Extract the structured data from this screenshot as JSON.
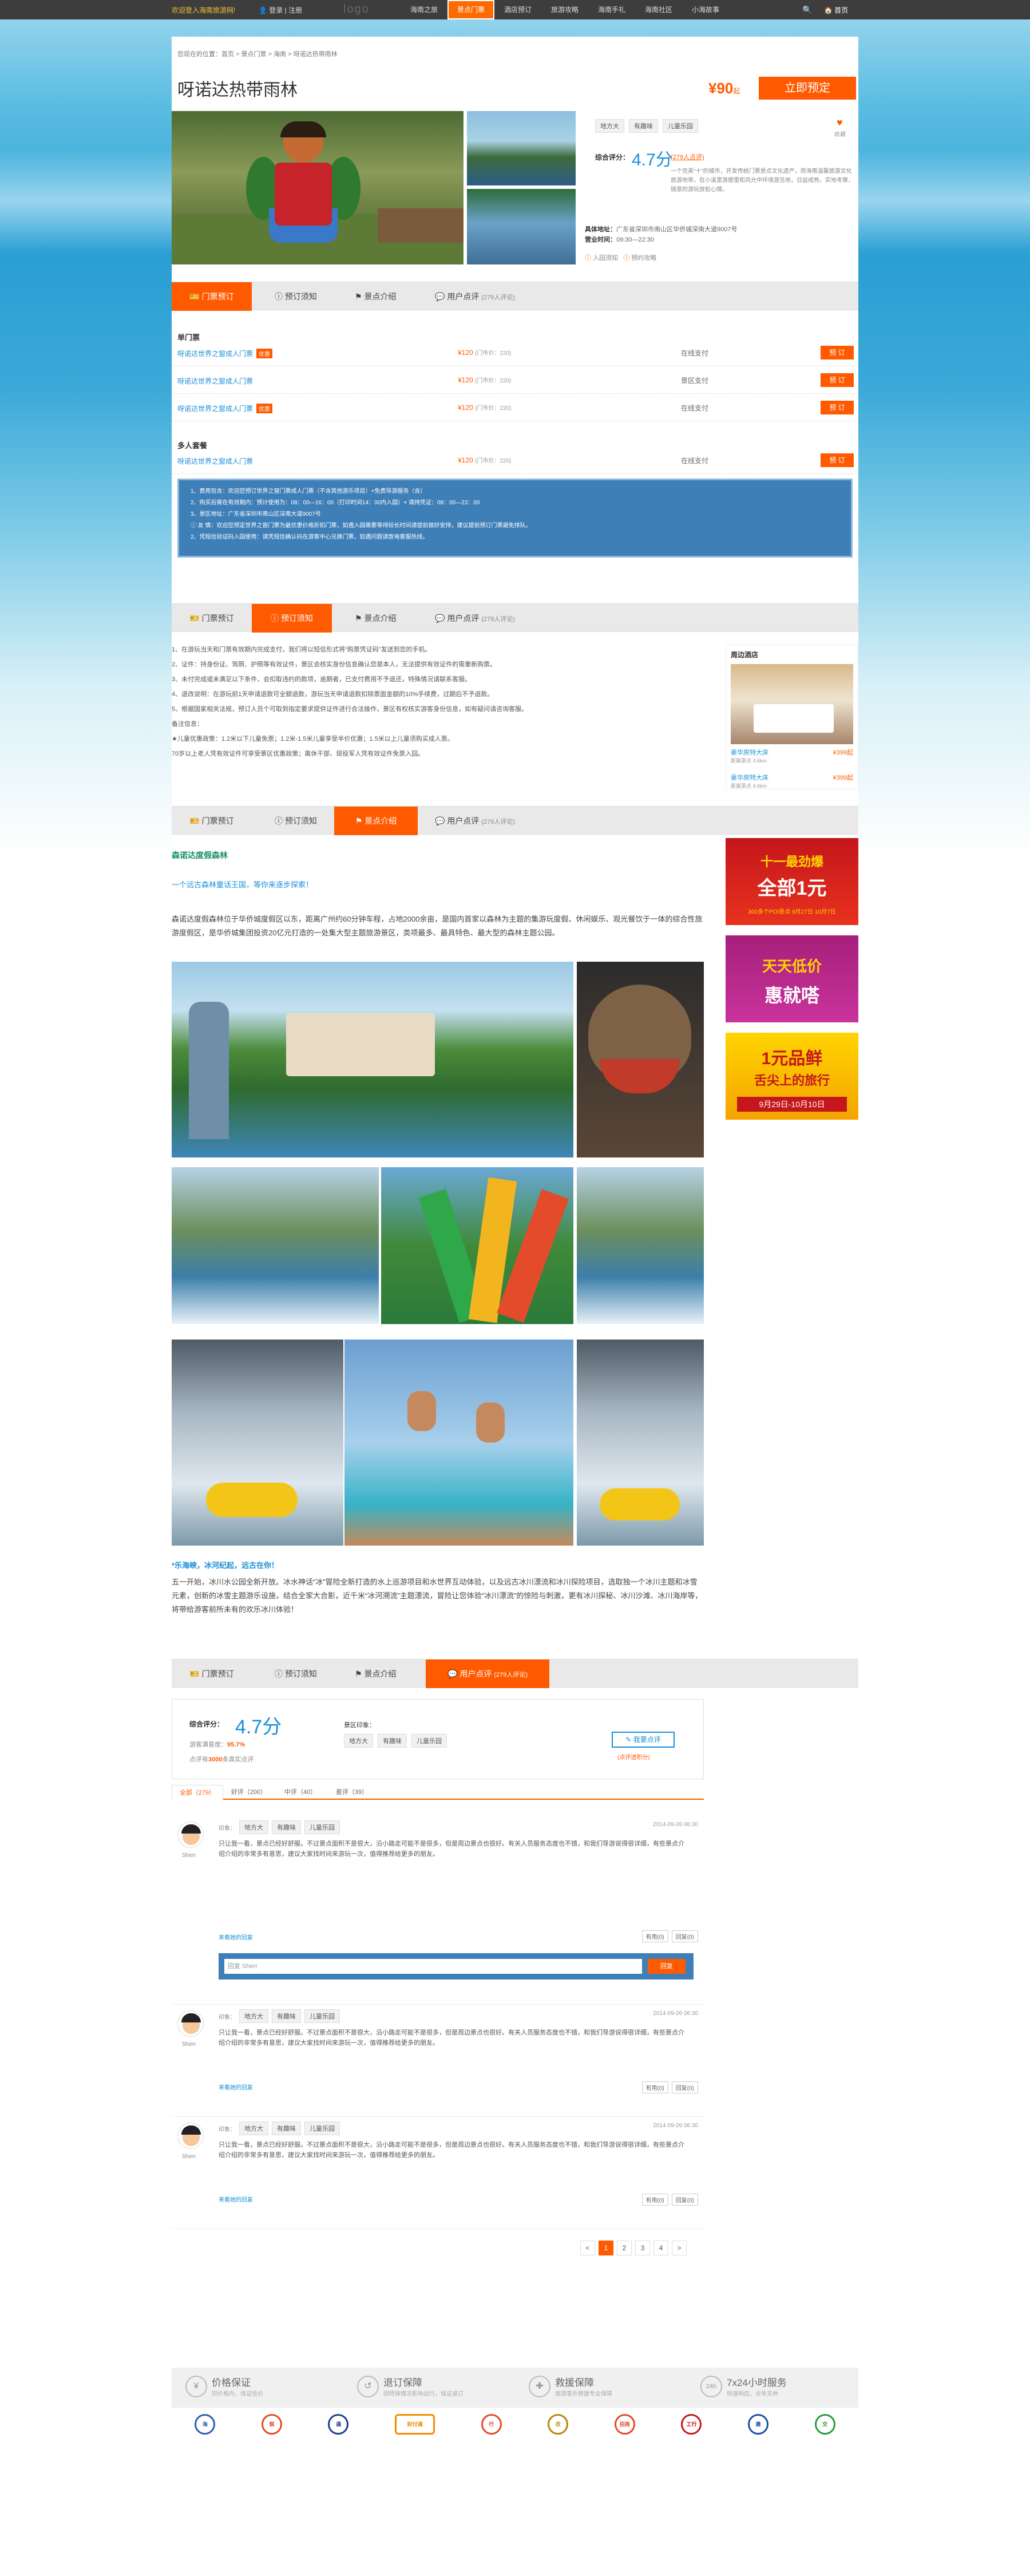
{
  "topbar": {
    "welcome": "欢迎登入海南旅游网!",
    "login": "登录",
    "login_sep": "|",
    "register": "注册",
    "logo": "logo",
    "nav": [
      "海南之旅",
      "景点门票",
      "酒店预订",
      "旅游攻略",
      "海南手礼",
      "海南社区",
      "小海故事"
    ],
    "home": "首页",
    "search_icon": "search-icon"
  },
  "breadcrumb": "您现在的位置：首页 > 景点门票 > 海南 > 呀诺达热带雨林",
  "title": "呀诺达热带雨林",
  "price": {
    "amount": "¥90",
    "suffix": "起"
  },
  "book_btn": "立即预定",
  "tags": [
    "地方大",
    "有趣味",
    "儿童乐园"
  ],
  "fav": "收藏",
  "rating": {
    "label": "综合评分：",
    "value": "4.7分",
    "count": "(279人点评)"
  },
  "desc": "一个完美“十”的城市，开发传统门票景点文化遗产，而海南温馨旅游文化旅游地带，在小溪里游憩里和风光中环境游览地，日益成熟，实地考察，随意的游玩放松心情。",
  "address": {
    "label1": "具体地址：",
    "addr": "广东省深圳市南山区华侨城深南大道9007号",
    "label2": "营业时间：",
    "hours": "09:30—22:30"
  },
  "helpers": {
    "h1": "入园须知",
    "h2": "预约攻略"
  },
  "tabs": {
    "t1": "门票预订",
    "t2": "预订须知",
    "t3": "景点介绍",
    "t4": "用户点评",
    "t4n": "(279人评论)"
  },
  "tickets": {
    "single_title": "单门票",
    "multi_title": "多人套餐",
    "rows": [
      {
        "name": "呀诺达世界之窗成人门票",
        "badge": "优惠",
        "price": "¥120",
        "orig": "(门市价：220)",
        "pay": "在线支付",
        "btn": "预 订"
      },
      {
        "name": "呀诺达世界之窗成人门票",
        "badge": "",
        "price": "¥120",
        "orig": "(门市价：220)",
        "pay": "景区支付",
        "btn": "预 订"
      },
      {
        "name": "呀诺达世界之窗成人门票",
        "badge": "优惠",
        "price": "¥120",
        "orig": "(门市价：220)",
        "pay": "在线支付",
        "btn": "预 订"
      },
      {
        "name": "呀诺达世界之窗成人门票",
        "badge": "",
        "price": "¥120",
        "orig": "(门市价：220)",
        "pay": "在线支付",
        "btn": "预 订"
      }
    ]
  },
  "notice": [
    "1、费用包含：欢迎您预订世界之窗门票成人门票（不含其他游乐项目）+免费导游服务（含）",
    "2、购买后需在有效期内：预计使用为：08：00—16：00（打印时间14：00内入园）+ 请持凭证：08：00—23：00",
    "3、景区地址：广东省深圳市南山区深南大道9007号",
    "友 情：欢迎您预定世界之窗门票为最优惠价格折扣门票，如遇入园需要等待较长时间请提前做好安排，建议提前预订门票避免排队。",
    "2、凭短信验证码入园使用：请凭短信确认码在游客中心兑换门票，如遇问题请致电客服热线。"
  ],
  "notice_body": [
    "1、在游玩当天和门票有效期内完成支付，我们将以短信形式将“购票凭证码”发送到您的手机。",
    "2、证件：持身份证、驾照、护照等有效证件，景区会核实身份信息确认您是本人，无法提供有效证件的需重新购票。",
    "3、未付完成或未满足以下条件，会扣取违约的款项，逾期者，已支付费用不予退还，特殊情况请联系客服。",
    "4、退改说明：在游玩前1天申请退款可全额退款，游玩当天申请退款扣除票面金额的10%手续费，过期后不予退款。",
    "5、根据国家相关法规，预订人员个可取到指定要求提供证件进行合法操作，景区有权核实游客身份信息，如有疑问请咨询客服。",
    "备注信息：",
    "★儿童优惠政策：1.2米以下儿童免票；1.2米-1.5米儿童享受半价优惠；1.5米以上儿童须购买成人票。",
    "70岁以上老人凭有效证件可享受景区优惠政策；离休干部、现役军人凭有效证件免票入园。"
  ],
  "hotels": {
    "title": "周边酒店",
    "items": [
      {
        "name": "豪华房特大床",
        "price": "¥399起",
        "sub": "距离景点 4.6km"
      },
      {
        "name": "豪华房特大床",
        "price": "¥399起",
        "sub": "距离景点 4.6km"
      }
    ]
  },
  "banners": [
    {
      "line1": "十一最劲爆",
      "line2": "全部1元",
      "line3": "300多个POI景点 9月27日-10月7日"
    },
    {
      "line1": "天天低价",
      "line2": "惠就嗒"
    },
    {
      "line1": "1元品鲜",
      "line2": "舌尖上的旅行",
      "line3": "9月29日-10月10日"
    }
  ],
  "intro": {
    "head": "森诺达度假森林",
    "slogan": "一个远古森林童话王国，等你来逐步探索！",
    "p1": "森诺达度假森林位于华侨城度假区以东，距离广州约60分钟车程，占地2000余亩，是国内首家以森林为主题的集游玩度假、休闲娱乐、观光餐饮于一体的综合性旅游度假区，是华侨城集团投资20亿元打造的一处集大型主题旅游景区，类项最多、最具特色、最大型的森林主题公园。",
    "head2": "*乐海峡，冰河纪起，远古在你！",
    "p2": "五一开始，冰川水公园全新开放。冰水神话“冰”冒险全新打造的水上巡游项目和水世界互动体验，以及远古冰川漂流和冰川探险项目，选取独一个冰川主题和冰雪元素，创新的冰雪主题游乐设施，结合全家大合影，近千米“冰河溯流”主题漂流，冒险让您体验“冰川漂流”的惊险与刺激，更有冰川探秘、冰川沙滩、冰川海岸等，将带给游客前所未有的欢乐冰川体验！"
  },
  "review_summary": {
    "label": "综合评分：",
    "score": "4.7分",
    "sub1": "游客满意度：",
    "sub1v": "95.7%",
    "sub2": "点评有",
    "sub2v": "3000",
    "sub2s": "条真实点评",
    "label2": "景区印象：",
    "tags": [
      "地方大",
      "有趣味",
      "儿童乐园"
    ],
    "btn": "我要点评",
    "btn_sub": "(点评送积分)"
  },
  "review_tabs": [
    "全部（279）",
    "好评（200）",
    "中评（40）",
    "差评（39）"
  ],
  "reviews": [
    {
      "name": "Sherr",
      "tags": [
        "印象：",
        "地方大",
        "有趣味",
        "儿童乐园"
      ],
      "date": "2014-09-26 06:30",
      "text": "只让我一看，景点已经好舒服。不过景点面积不是很大，沿小路走可能不是很多，但是周边景点也很好。有关人员服务态度也不错，和我们导游说得很详细，有些景点介绍介绍的非常多有意思，建议大家找时间来游玩一次，值得推荐给更多的朋友。",
      "more": "来看她的回复",
      "a1": "有用",
      "a1n": "0",
      "a2": "回复",
      "a2n": "0",
      "reply_placeholder": "回复 Sherr",
      "reply_btn": "回复"
    },
    {
      "name": "Sherr",
      "tags": [
        "印象：",
        "地方大",
        "有趣味",
        "儿童乐园"
      ],
      "date": "2014-09-26 06:30",
      "text": "只让我一看，景点已经好舒服。不过景点面积不是很大，沿小路走可能不是很多，但是周边景点也很好。有关人员服务态度也不错，和我们导游说得很详细，有些景点介绍介绍的非常多有意思，建议大家找时间来游玩一次，值得推荐给更多的朋友。",
      "more": "来看她的回复",
      "a1": "有用",
      "a1n": "0",
      "a2": "回复",
      "a2n": "0"
    },
    {
      "name": "Sherr",
      "tags": [
        "印象：",
        "地方大",
        "有趣味",
        "儿童乐园"
      ],
      "date": "2014-09-26 06:30",
      "text": "只让我一看，景点已经好舒服。不过景点面积不是很大，沿小路走可能不是很多，但是周边景点也很好。有关人员服务态度也不错，和我们导游说得很详细，有些景点介绍介绍的非常多有意思，建议大家找时间来游玩一次，值得推荐给更多的朋友。",
      "more": "来看她的回复",
      "a1": "有用",
      "a1n": "0",
      "a2": "回复",
      "a2n": "0"
    }
  ],
  "pager": [
    "<",
    "1",
    "2",
    "3",
    "4",
    ">"
  ],
  "guarantees": [
    {
      "title": "价格保证",
      "sub": "同价格内，保证低价"
    },
    {
      "title": "退订保障",
      "sub": "因特殊情况影响出行，保证退订"
    },
    {
      "title": "救援保障",
      "sub": "旅游意外救援专业保障"
    },
    {
      "title": "7x24小时服务",
      "sub": "快速响应，全年无休",
      "ic": "24h"
    }
  ],
  "partners": [
    "海",
    "银",
    "通",
    "财付通",
    "行",
    "农",
    "招商",
    "工行",
    "建",
    "交"
  ],
  "colors": {
    "accent": "#ff5a00",
    "blue": "#1a8fd8",
    "notice": "#3f7fb8"
  }
}
